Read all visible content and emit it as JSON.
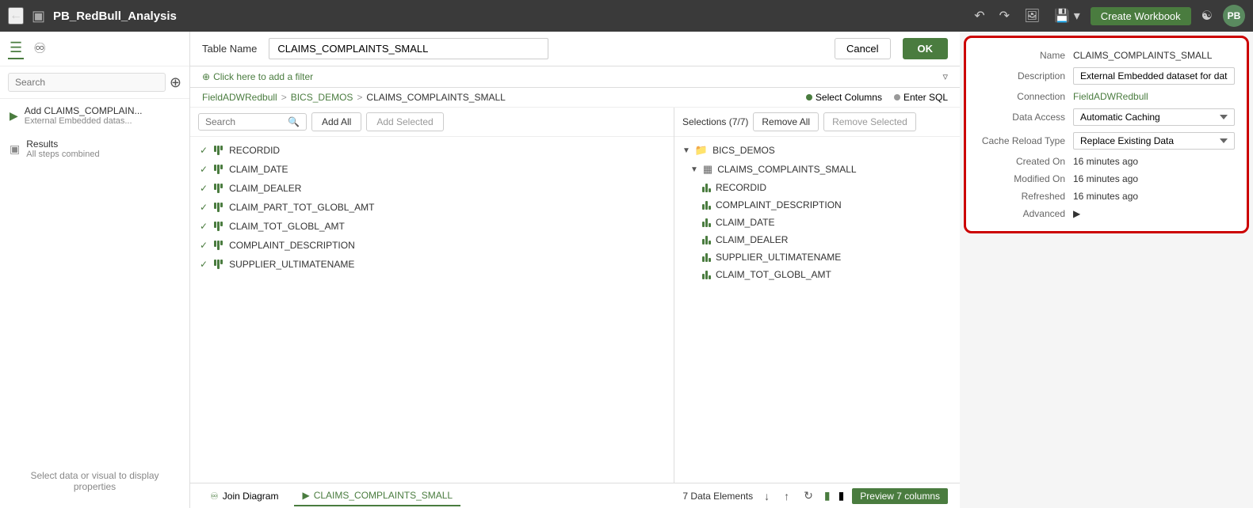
{
  "topbar": {
    "title": "PB_RedBull_Analysis",
    "create_workbook": "Create Workbook",
    "back_icon": "←",
    "avatar": "PB"
  },
  "table_header": {
    "label": "Table Name",
    "value": "CLAIMS_COMPLAINTS_SMALL",
    "cancel": "Cancel",
    "ok": "OK"
  },
  "filter": {
    "add_filter": "Click here to add a filter"
  },
  "breadcrumb": {
    "part1": "FieldADWRedbull",
    "sep1": ">",
    "part2": "BICS_DEMOS",
    "sep2": ">",
    "part3": "CLAIMS_COMPLAINTS_SMALL",
    "mode1": "Select Columns",
    "mode2": "Enter SQL"
  },
  "sidebar": {
    "search_placeholder": "Search",
    "item1_title": "Add CLAIMS_COMPLAIN...",
    "item1_sub": "External Embedded datas...",
    "results_title": "Results",
    "results_sub": "All steps combined",
    "select_hint": "Select data or visual to display properties"
  },
  "columns": {
    "search_placeholder": "Search",
    "add_all": "Add All",
    "add_selected": "Add Selected",
    "items": [
      "RECORDID",
      "CLAIM_DATE",
      "CLAIM_DEALER",
      "CLAIM_PART_TOT_GLOBL_AMT",
      "CLAIM_TOT_GLOBL_AMT",
      "COMPLAINT_DESCRIPTION",
      "SUPPLIER_ULTIMATENAME"
    ]
  },
  "selections": {
    "label": "Selections (7/7)",
    "remove_all": "Remove All",
    "remove_selected": "Remove Selected",
    "tree": {
      "folder": "BICS_DEMOS",
      "table": "CLAIMS_COMPLAINTS_SMALL",
      "columns": [
        "RECORDID",
        "COMPLAINT_DESCRIPTION",
        "CLAIM_DATE",
        "CLAIM_DEALER",
        "SUPPLIER_ULTIMATENAME",
        "CLAIM_TOT_GLOBL_AMT"
      ]
    }
  },
  "info_panel": {
    "name_label": "Name",
    "name_value": "CLAIMS_COMPLAINTS_SMALL",
    "description_label": "Description",
    "description_value": "External Embedded dataset for datamodel",
    "connection_label": "Connection",
    "connection_value": "FieldADWRedbull",
    "data_access_label": "Data Access",
    "data_access_value": "Automatic Caching",
    "cache_reload_label": "Cache Reload Type",
    "cache_reload_value": "Replace Existing Data",
    "created_label": "Created On",
    "created_value": "16 minutes ago",
    "modified_label": "Modified On",
    "modified_value": "16 minutes ago",
    "refreshed_label": "Refreshed",
    "refreshed_value": "16 minutes ago",
    "advanced_label": "Advanced"
  },
  "bottom_bar": {
    "join_diagram": "Join Diagram",
    "table_tab": "CLAIMS_COMPLAINTS_SMALL",
    "data_elements": "7 Data Elements",
    "preview": "Preview 7 columns"
  }
}
